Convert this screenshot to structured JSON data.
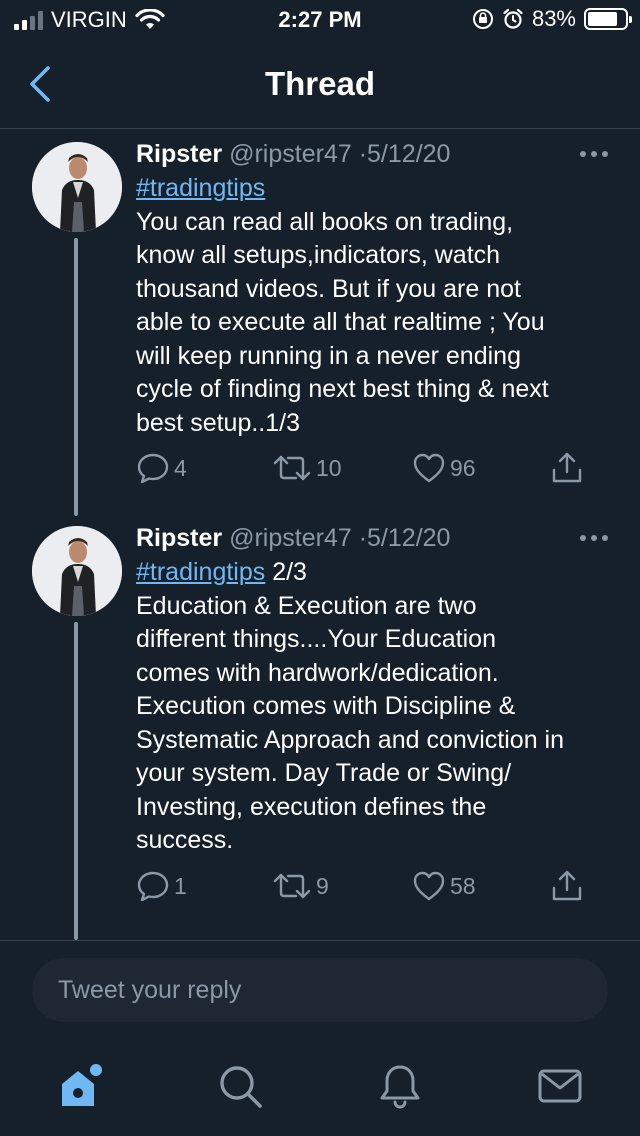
{
  "status_bar": {
    "carrier": "VIRGIN",
    "time": "2:27 PM",
    "battery": "83%",
    "battery_level": 0.83,
    "signal_bars": 2
  },
  "header": {
    "title": "Thread",
    "back_icon": "chevron-left-icon"
  },
  "tweets": [
    {
      "name": "Ripster",
      "handle": "@ripster47",
      "sep": "·",
      "date": "5/12/20",
      "hashtag": "#tradingtips",
      "hashtag_suffix": "",
      "lines": [
        "You can read all books on trading,",
        "know all setups,indicators, watch",
        "thousand videos. But if you are not",
        "able to execute all that realtime ; You",
        "will keep running in a never ending",
        "cycle of finding next best thing  & next",
        "best setup..1/3"
      ],
      "replies": "4",
      "retweets": "10",
      "likes": "96"
    },
    {
      "name": "Ripster",
      "handle": "@ripster47",
      "sep": "·",
      "date": "5/12/20",
      "hashtag": "#tradingtips",
      "hashtag_suffix": " 2/3",
      "lines": [
        "Education & Execution are two",
        "different things....Your Education",
        "comes with hardwork/dedication.",
        "Execution comes with Discipline &",
        "Systematic Approach and conviction in",
        "your system. Day Trade or Swing/",
        "Investing, execution defines the",
        "success."
      ],
      "replies": "1",
      "retweets": "9",
      "likes": "58"
    }
  ],
  "reply_box": {
    "placeholder": "Tweet your reply"
  },
  "tab_bar": {
    "items": [
      "home-icon",
      "search-icon",
      "notifications-icon",
      "messages-icon"
    ],
    "active": "home-icon"
  },
  "colors": {
    "background": "#15202b",
    "accent": "#6fb8f5",
    "muted": "#8b98a5",
    "divider": "#38444d"
  }
}
